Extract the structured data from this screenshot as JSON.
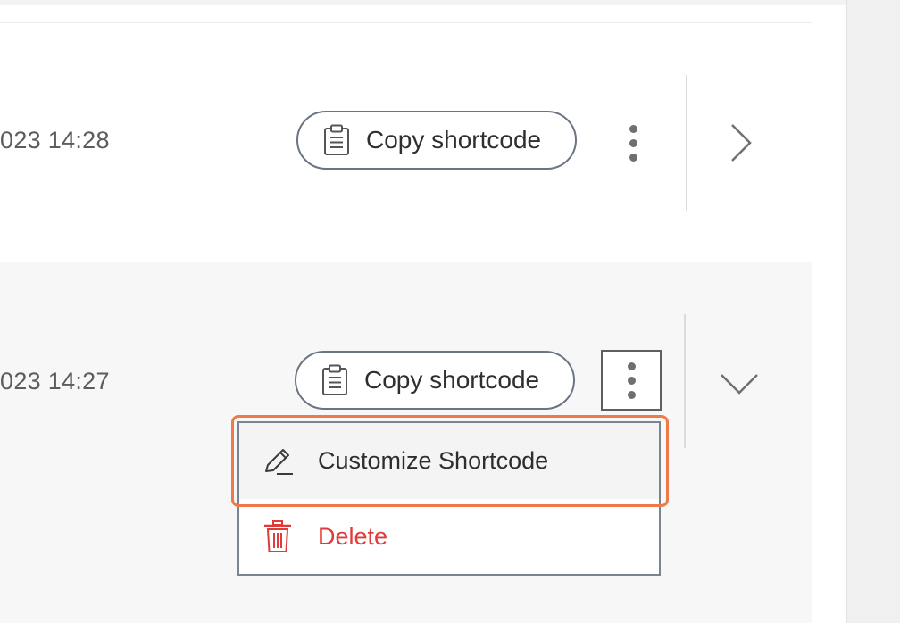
{
  "rows": [
    {
      "timestamp": "023 14:28",
      "copy_label": "Copy shortcode",
      "expand_icon": "chevron-right-icon"
    },
    {
      "timestamp": "023 14:27",
      "copy_label": "Copy shortcode",
      "expand_icon": "chevron-down-icon"
    }
  ],
  "context_menu": {
    "items": [
      {
        "label": "Customize Shortcode",
        "icon": "pencil-icon",
        "highlighted": true
      },
      {
        "label": "Delete",
        "icon": "trash-icon",
        "color": "#e03a3a"
      }
    ]
  },
  "colors": {
    "highlight_outline": "#ee7a48",
    "delete": "#e03a3a",
    "button_border": "#6a7482"
  }
}
